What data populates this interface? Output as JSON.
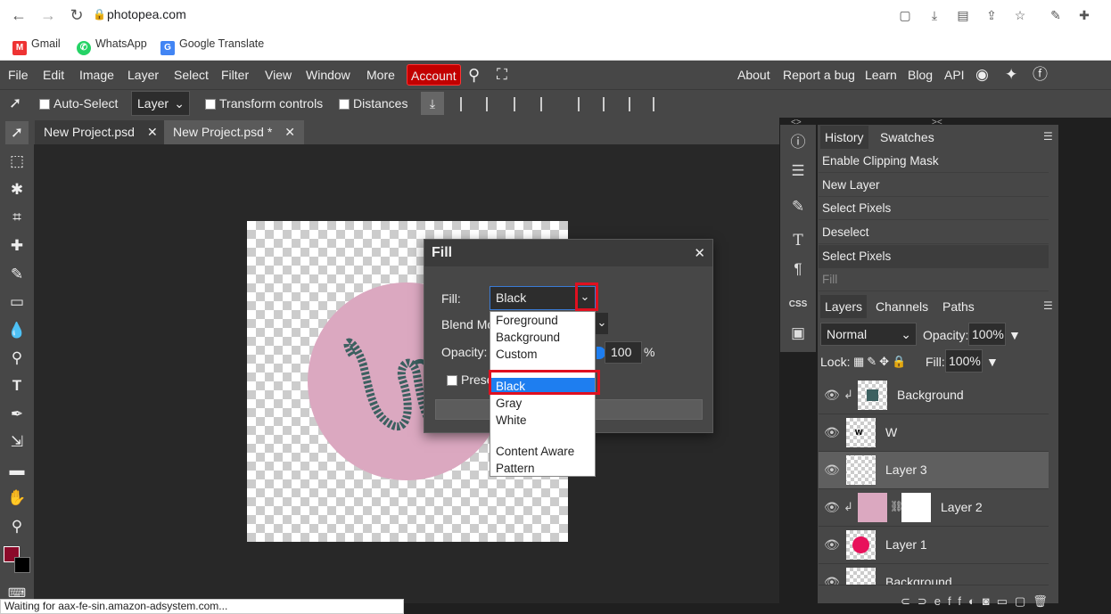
{
  "browser": {
    "url": "photopea.com",
    "bookmarks": [
      "Gmail",
      "WhatsApp",
      "Google Translate"
    ],
    "status": "Waiting for aax-fe-sin.amazon-adsystem.com..."
  },
  "menu": {
    "items": [
      "File",
      "Edit",
      "Image",
      "Layer",
      "Select",
      "Filter",
      "View",
      "Window",
      "More"
    ],
    "account": "Account",
    "right": [
      "About",
      "Report a bug",
      "Learn",
      "Blog",
      "API"
    ]
  },
  "options": {
    "auto_select": "Auto-Select",
    "layer_select": "Layer",
    "transform": "Transform controls",
    "distances": "Distances"
  },
  "tabs": [
    {
      "label": "New Project.psd"
    },
    {
      "label": "New Project.psd *"
    }
  ],
  "dialog": {
    "title": "Fill",
    "fill_label": "Fill:",
    "fill_value": "Black",
    "blend_label": "Blend Mo",
    "opacity_label": "Opacity:",
    "opacity_value": "100",
    "opacity_unit": "%",
    "preserve_label": "Prese",
    "options": [
      "Foreground",
      "Background",
      "Custom",
      "Black",
      "Gray",
      "White",
      "Content Aware",
      "Pattern"
    ],
    "selected": "Black"
  },
  "panels": {
    "top_tabs": [
      "History",
      "Swatches"
    ],
    "history": [
      "Enable Clipping Mask",
      "New Layer",
      "Select Pixels",
      "Deselect",
      "Select Pixels",
      "Fill"
    ],
    "layer_tabs": [
      "Layers",
      "Channels",
      "Paths"
    ],
    "blend_mode": "Normal",
    "opacity_label": "Opacity:",
    "opacity": "100%",
    "lock_label": "Lock:",
    "fill_label": "Fill:",
    "fill": "100%",
    "layers": [
      {
        "name": "Background"
      },
      {
        "name": "W"
      },
      {
        "name": "Layer 3"
      },
      {
        "name": "Layer 2"
      },
      {
        "name": "Layer 1"
      },
      {
        "name": "Background"
      }
    ],
    "bottom_icons": [
      "eff"
    ]
  },
  "colors": {
    "foreground": "#8b0a2a",
    "background": "#000000",
    "accent": "#c20000",
    "selection": "#1e7ef0"
  }
}
